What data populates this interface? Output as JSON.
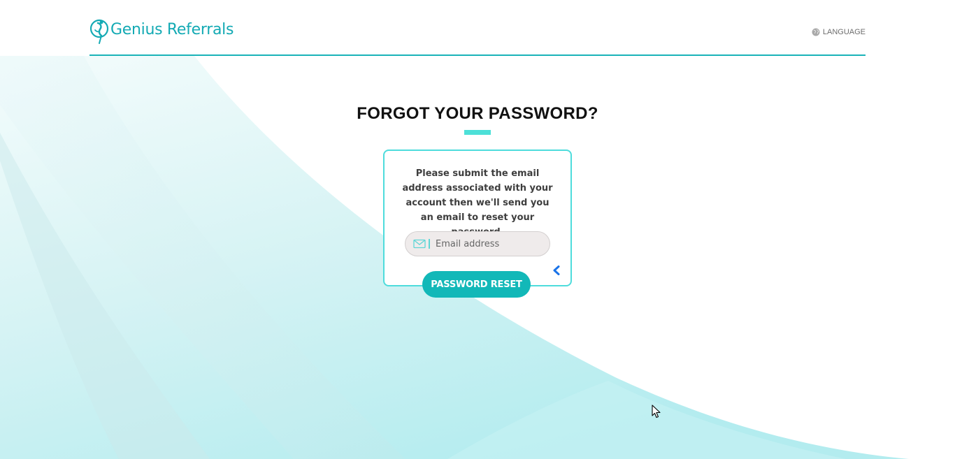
{
  "header": {
    "logo_text": "Genius Referrals",
    "language_label": "LANGUAGE"
  },
  "main": {
    "title": "FORGOT YOUR PASSWORD?",
    "message": "Please submit the email address associated with your account then we'll send you an email to reset your password.",
    "email_placeholder": "Email address",
    "email_value": "",
    "reset_button_label": "PASSWORD RESET"
  },
  "icons": {
    "logo": "genius-referrals-logo-icon",
    "language": "globe-icon",
    "email": "mail-icon",
    "back": "chevron-left-icon",
    "cursor": "mouse-pointer-icon"
  },
  "colors": {
    "brand_teal": "#14aab4",
    "button": "#12b8b8",
    "card_border": "#4edcdc",
    "title_accent": "#4de0d8",
    "background_wave": "#b8eef0",
    "back_icon": "#1a73e8"
  }
}
